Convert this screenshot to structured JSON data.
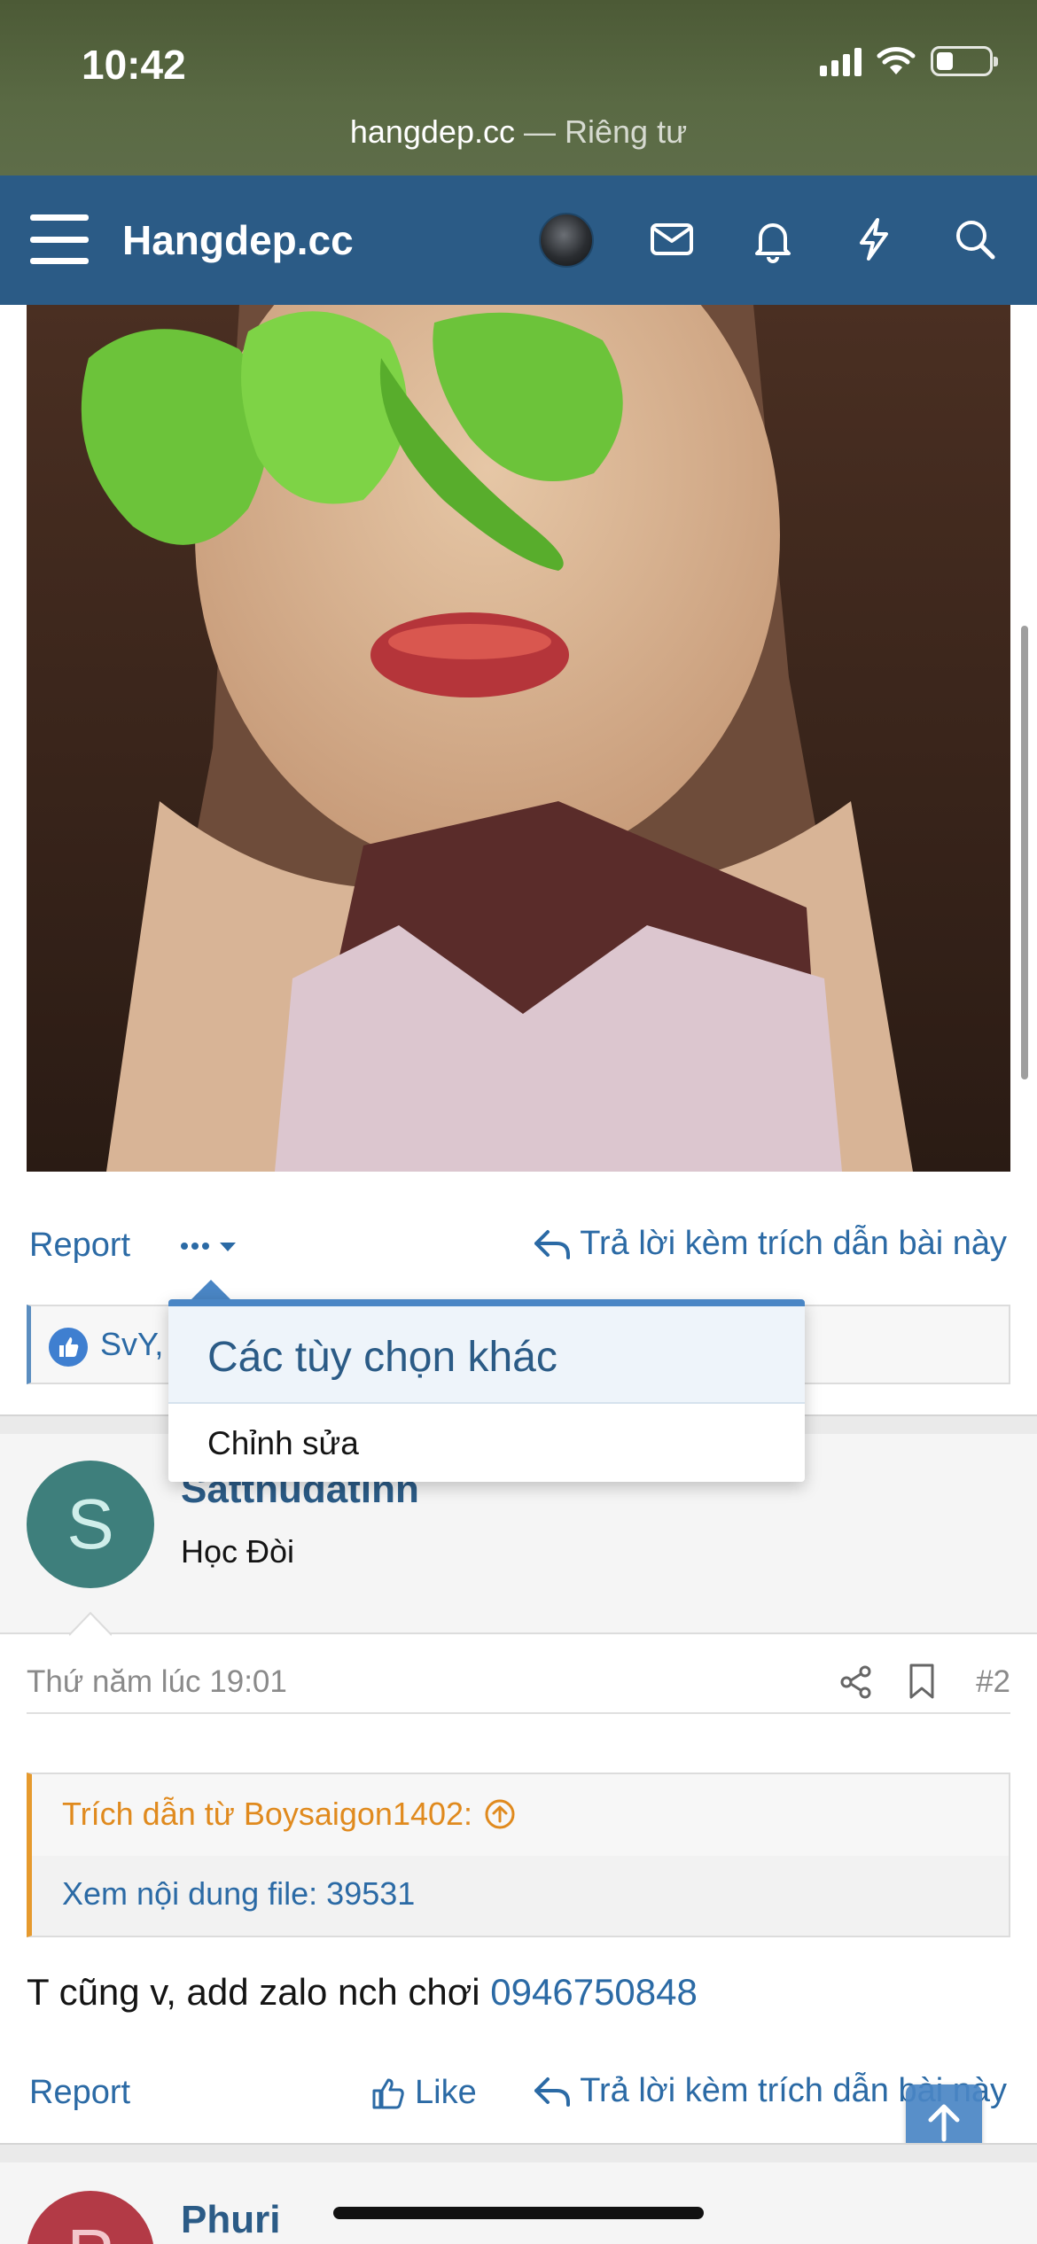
{
  "status_bar": {
    "time": "10:42"
  },
  "browser": {
    "domain": "hangdep.cc",
    "separator": " — ",
    "mode": "Riêng tư"
  },
  "navbar": {
    "brand": "Hangdep.cc",
    "icons": [
      "menu-icon",
      "user-avatar",
      "envelope-icon",
      "bell-icon",
      "lightning-icon",
      "search-icon"
    ]
  },
  "post1": {
    "report": "Report",
    "more_icon": "ellipsis-icon",
    "reply_quote": "Trả lời kèm trích dẫn bài này",
    "likes_text": "SvY,"
  },
  "dropdown": {
    "header": "Các tùy chọn khác",
    "items": [
      {
        "label": "Chỉnh sửa"
      }
    ]
  },
  "post2": {
    "author_initial": "S",
    "author": "Sattnudatinn",
    "user_title": "Học Đòi",
    "date": "Thứ năm lúc 19:01",
    "post_number": "#2",
    "quote_header": "Trích dẫn từ Boysaigon1402:",
    "quote_link": "Xem nội dung file: 39531",
    "body_text": "T cũng v, add zalo nch chơi ",
    "phone": "0946750848",
    "report": "Report",
    "like": "Like",
    "reply_quote": "Trả lời kèm trích dẫn bài này"
  },
  "post3": {
    "author_initial": "P",
    "author": "Phuri"
  },
  "colors": {
    "nav_bg": "#2b5b86",
    "link": "#2b6aa5",
    "quote_accent": "#e69a2e",
    "avatar_s": "#3e7f7c",
    "avatar_p": "#b33a46"
  }
}
